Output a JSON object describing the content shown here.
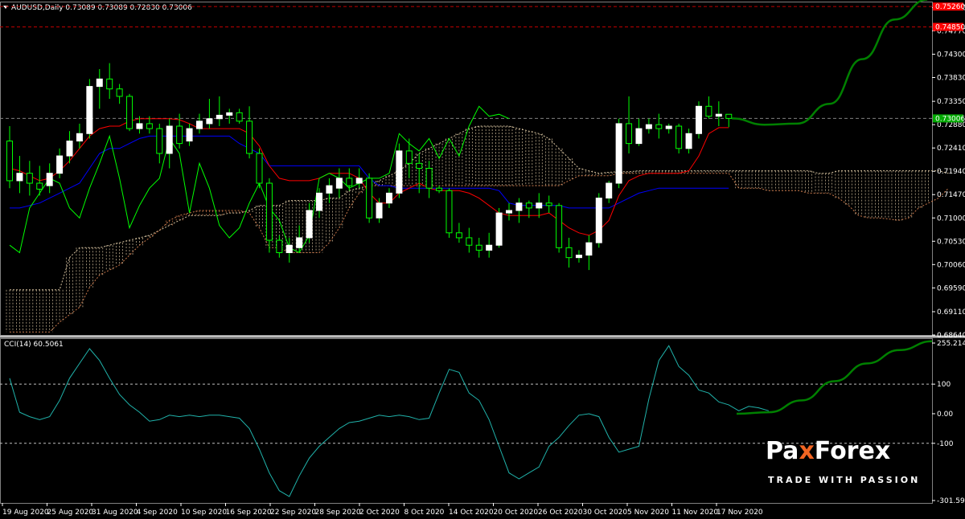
{
  "header": {
    "symbol_label": "AUDUSD,Daily",
    "ohlc_label": "0.73089 0.73089 0.72830 0.73006"
  },
  "indicator": {
    "label": "CCI(14) 60.5061"
  },
  "colors": {
    "background": "#000000",
    "bull_candle": "#ffffff",
    "bear_candle": "#000000",
    "wick": "#00ff00",
    "tenkan": "#ff0000",
    "kijun": "#0000ff",
    "chikou": "#00ff00",
    "cloud_a": "#d7c3a0",
    "cloud_b": "#c8784b",
    "cci": "#20b2aa",
    "forecast": "#008000",
    "level_line": "#c00000",
    "price_tag": "#ff0000",
    "current_tag": "#00aa00"
  },
  "chart_data": [
    {
      "type": "candlestick",
      "title": "AUDUSD,Daily",
      "ylim": [
        0.6864,
        0.7536
      ],
      "y_ticks": [
        "0.75240",
        "0.74770",
        "0.74300",
        "0.73830",
        "0.73350",
        "0.72880",
        "0.72410",
        "0.71940",
        "0.71470",
        "0.71000",
        "0.70530",
        "0.70060",
        "0.69590",
        "0.69110",
        "0.68640"
      ],
      "price_tags": [
        {
          "label": "0.75260",
          "value": 0.7526,
          "color": "#ff0000"
        },
        {
          "label": "0.74850",
          "value": 0.7485,
          "color": "#ff0000"
        },
        {
          "label": "0.73006",
          "value": 0.73006,
          "color": "#00aa00"
        }
      ],
      "x_labels": [
        "19 Aug 2020",
        "25 Aug 2020",
        "31 Aug 2020",
        "4 Sep 2020",
        "10 Sep 2020",
        "16 Sep 2020",
        "22 Sep 2020",
        "28 Sep 2020",
        "2 Oct 2020",
        "8 Oct 2020",
        "14 Oct 2020",
        "20 Oct 2020",
        "26 Oct 2020",
        "30 Oct 2020",
        "5 Nov 2020",
        "11 Nov 2020",
        "17 Nov 2020"
      ],
      "candles": [
        {
          "o": 0.7255,
          "h": 0.7285,
          "l": 0.716,
          "c": 0.7175
        },
        {
          "o": 0.7175,
          "h": 0.7225,
          "l": 0.715,
          "c": 0.719
        },
        {
          "o": 0.719,
          "h": 0.7215,
          "l": 0.7145,
          "c": 0.717
        },
        {
          "o": 0.717,
          "h": 0.7205,
          "l": 0.7145,
          "c": 0.7158
        },
        {
          "o": 0.7165,
          "h": 0.721,
          "l": 0.715,
          "c": 0.719
        },
        {
          "o": 0.719,
          "h": 0.724,
          "l": 0.718,
          "c": 0.7225
        },
        {
          "o": 0.7225,
          "h": 0.7275,
          "l": 0.721,
          "c": 0.7255
        },
        {
          "o": 0.7255,
          "h": 0.729,
          "l": 0.724,
          "c": 0.727
        },
        {
          "o": 0.727,
          "h": 0.738,
          "l": 0.726,
          "c": 0.7365
        },
        {
          "o": 0.7365,
          "h": 0.74,
          "l": 0.732,
          "c": 0.738
        },
        {
          "o": 0.738,
          "h": 0.7412,
          "l": 0.734,
          "c": 0.736
        },
        {
          "o": 0.736,
          "h": 0.737,
          "l": 0.733,
          "c": 0.7345
        },
        {
          "o": 0.7345,
          "h": 0.735,
          "l": 0.7275,
          "c": 0.728
        },
        {
          "o": 0.728,
          "h": 0.7305,
          "l": 0.727,
          "c": 0.729
        },
        {
          "o": 0.729,
          "h": 0.7305,
          "l": 0.727,
          "c": 0.728
        },
        {
          "o": 0.728,
          "h": 0.729,
          "l": 0.721,
          "c": 0.723
        },
        {
          "o": 0.723,
          "h": 0.73,
          "l": 0.72,
          "c": 0.7285
        },
        {
          "o": 0.7285,
          "h": 0.731,
          "l": 0.724,
          "c": 0.725
        },
        {
          "o": 0.7255,
          "h": 0.729,
          "l": 0.7245,
          "c": 0.728
        },
        {
          "o": 0.728,
          "h": 0.731,
          "l": 0.727,
          "c": 0.7295
        },
        {
          "o": 0.729,
          "h": 0.734,
          "l": 0.728,
          "c": 0.73
        },
        {
          "o": 0.73,
          "h": 0.7345,
          "l": 0.7285,
          "c": 0.7307
        },
        {
          "o": 0.7307,
          "h": 0.732,
          "l": 0.729,
          "c": 0.7312
        },
        {
          "o": 0.7312,
          "h": 0.732,
          "l": 0.729,
          "c": 0.7295
        },
        {
          "o": 0.7295,
          "h": 0.7325,
          "l": 0.722,
          "c": 0.723
        },
        {
          "o": 0.723,
          "h": 0.724,
          "l": 0.716,
          "c": 0.717
        },
        {
          "o": 0.717,
          "h": 0.718,
          "l": 0.703,
          "c": 0.7055
        },
        {
          "o": 0.7055,
          "h": 0.7065,
          "l": 0.702,
          "c": 0.703
        },
        {
          "o": 0.703,
          "h": 0.706,
          "l": 0.701,
          "c": 0.7045
        },
        {
          "o": 0.704,
          "h": 0.7085,
          "l": 0.703,
          "c": 0.706
        },
        {
          "o": 0.706,
          "h": 0.713,
          "l": 0.705,
          "c": 0.7115
        },
        {
          "o": 0.7115,
          "h": 0.716,
          "l": 0.71,
          "c": 0.715
        },
        {
          "o": 0.715,
          "h": 0.718,
          "l": 0.713,
          "c": 0.7165
        },
        {
          "o": 0.716,
          "h": 0.72,
          "l": 0.714,
          "c": 0.718
        },
        {
          "o": 0.718,
          "h": 0.72,
          "l": 0.7155,
          "c": 0.7165
        },
        {
          "o": 0.717,
          "h": 0.72,
          "l": 0.716,
          "c": 0.718
        },
        {
          "o": 0.718,
          "h": 0.719,
          "l": 0.709,
          "c": 0.71
        },
        {
          "o": 0.71,
          "h": 0.714,
          "l": 0.709,
          "c": 0.713
        },
        {
          "o": 0.713,
          "h": 0.716,
          "l": 0.712,
          "c": 0.715
        },
        {
          "o": 0.715,
          "h": 0.725,
          "l": 0.714,
          "c": 0.7235
        },
        {
          "o": 0.7235,
          "h": 0.726,
          "l": 0.718,
          "c": 0.721
        },
        {
          "o": 0.721,
          "h": 0.723,
          "l": 0.715,
          "c": 0.72
        },
        {
          "o": 0.72,
          "h": 0.7215,
          "l": 0.714,
          "c": 0.716
        },
        {
          "o": 0.716,
          "h": 0.7165,
          "l": 0.715,
          "c": 0.7155
        },
        {
          "o": 0.7155,
          "h": 0.716,
          "l": 0.706,
          "c": 0.707
        },
        {
          "o": 0.707,
          "h": 0.709,
          "l": 0.705,
          "c": 0.706
        },
        {
          "o": 0.706,
          "h": 0.708,
          "l": 0.703,
          "c": 0.7045
        },
        {
          "o": 0.7045,
          "h": 0.706,
          "l": 0.702,
          "c": 0.7035
        },
        {
          "o": 0.7035,
          "h": 0.707,
          "l": 0.702,
          "c": 0.7045
        },
        {
          "o": 0.7045,
          "h": 0.712,
          "l": 0.704,
          "c": 0.711
        },
        {
          "o": 0.711,
          "h": 0.713,
          "l": 0.7095,
          "c": 0.7115
        },
        {
          "o": 0.7115,
          "h": 0.714,
          "l": 0.709,
          "c": 0.713
        },
        {
          "o": 0.713,
          "h": 0.7135,
          "l": 0.71,
          "c": 0.712
        },
        {
          "o": 0.712,
          "h": 0.715,
          "l": 0.71,
          "c": 0.713
        },
        {
          "o": 0.713,
          "h": 0.7145,
          "l": 0.711,
          "c": 0.7125
        },
        {
          "o": 0.7125,
          "h": 0.713,
          "l": 0.703,
          "c": 0.704
        },
        {
          "o": 0.704,
          "h": 0.706,
          "l": 0.7,
          "c": 0.702
        },
        {
          "o": 0.702,
          "h": 0.7035,
          "l": 0.701,
          "c": 0.7025
        },
        {
          "o": 0.7025,
          "h": 0.7065,
          "l": 0.6995,
          "c": 0.705
        },
        {
          "o": 0.705,
          "h": 0.715,
          "l": 0.704,
          "c": 0.714
        },
        {
          "o": 0.714,
          "h": 0.7175,
          "l": 0.713,
          "c": 0.717
        },
        {
          "o": 0.717,
          "h": 0.73,
          "l": 0.716,
          "c": 0.729
        },
        {
          "o": 0.729,
          "h": 0.7345,
          "l": 0.723,
          "c": 0.725
        },
        {
          "o": 0.725,
          "h": 0.73,
          "l": 0.7245,
          "c": 0.728
        },
        {
          "o": 0.728,
          "h": 0.73,
          "l": 0.727,
          "c": 0.7288
        },
        {
          "o": 0.7288,
          "h": 0.731,
          "l": 0.726,
          "c": 0.728
        },
        {
          "o": 0.728,
          "h": 0.729,
          "l": 0.727,
          "c": 0.7285
        },
        {
          "o": 0.7285,
          "h": 0.729,
          "l": 0.723,
          "c": 0.724
        },
        {
          "o": 0.724,
          "h": 0.728,
          "l": 0.723,
          "c": 0.727
        },
        {
          "o": 0.727,
          "h": 0.7335,
          "l": 0.726,
          "c": 0.7325
        },
        {
          "o": 0.7325,
          "h": 0.7345,
          "l": 0.73,
          "c": 0.7305
        },
        {
          "o": 0.7305,
          "h": 0.7335,
          "l": 0.7285,
          "c": 0.7309
        },
        {
          "o": 0.73089,
          "h": 0.73089,
          "l": 0.7283,
          "c": 0.73006
        }
      ],
      "tenkan": [
        0.72,
        0.7195,
        0.7185,
        0.7175,
        0.718,
        0.7195,
        0.7215,
        0.724,
        0.7265,
        0.728,
        0.7285,
        0.7285,
        0.7295,
        0.73,
        0.73,
        0.73,
        0.73,
        0.7298,
        0.729,
        0.728,
        0.728,
        0.728,
        0.728,
        0.728,
        0.727,
        0.7245,
        0.7205,
        0.718,
        0.7175,
        0.7175,
        0.7175,
        0.718,
        0.719,
        0.719,
        0.719,
        0.718,
        0.715,
        0.713,
        0.713,
        0.715,
        0.716,
        0.717,
        0.716,
        0.7155,
        0.7155,
        0.7155,
        0.715,
        0.714,
        0.7125,
        0.711,
        0.7105,
        0.7105,
        0.7105,
        0.7105,
        0.711,
        0.7095,
        0.708,
        0.707,
        0.7065,
        0.7075,
        0.7095,
        0.7145,
        0.7175,
        0.7185,
        0.719,
        0.719,
        0.719,
        0.719,
        0.7195,
        0.7225,
        0.727,
        0.7282,
        0.7282
      ],
      "kijun": [
        0.712,
        0.712,
        0.7125,
        0.713,
        0.714,
        0.715,
        0.716,
        0.717,
        0.72,
        0.723,
        0.724,
        0.724,
        0.725,
        0.726,
        0.7265,
        0.7265,
        0.7265,
        0.7265,
        0.7265,
        0.7265,
        0.7265,
        0.7265,
        0.7265,
        0.725,
        0.724,
        0.723,
        0.7205,
        0.7205,
        0.7205,
        0.7205,
        0.7205,
        0.7205,
        0.7205,
        0.7205,
        0.7205,
        0.7205,
        0.718,
        0.7165,
        0.7165,
        0.716,
        0.716,
        0.716,
        0.716,
        0.716,
        0.716,
        0.716,
        0.716,
        0.716,
        0.716,
        0.7155,
        0.713,
        0.7125,
        0.7125,
        0.7125,
        0.7125,
        0.7125,
        0.712,
        0.712,
        0.712,
        0.712,
        0.712,
        0.713,
        0.714,
        0.715,
        0.7155,
        0.716,
        0.716,
        0.716,
        0.716,
        0.716,
        0.716,
        0.716,
        0.716
      ],
      "chikou": [
        0.7045,
        0.703,
        0.712,
        0.715,
        0.718,
        0.717,
        0.712,
        0.71,
        0.716,
        0.721,
        0.7265,
        0.718,
        0.708,
        0.7125,
        0.716,
        0.718,
        0.726,
        0.723,
        0.711,
        0.721,
        0.716,
        0.7085,
        0.706,
        0.708,
        0.713,
        0.717,
        0.712,
        0.7095,
        0.704,
        0.703,
        0.7065,
        0.718,
        0.719,
        0.718,
        0.716,
        0.717,
        0.718,
        0.718,
        0.719,
        0.727,
        0.725,
        0.7235,
        0.726,
        0.722,
        0.726,
        0.7225,
        0.7285,
        0.7325,
        0.7305,
        0.7309,
        0.73
      ],
      "cloud_a": [
        0.6955,
        0.6955,
        0.6955,
        0.6955,
        0.6955,
        0.6955,
        0.702,
        0.704,
        0.704,
        0.704,
        0.7045,
        0.705,
        0.7055,
        0.706,
        0.7065,
        0.7075,
        0.7085,
        0.7095,
        0.7105,
        0.7105,
        0.7105,
        0.7105,
        0.711,
        0.711,
        0.7115,
        0.7125,
        0.7125,
        0.7125,
        0.7135,
        0.7135,
        0.7135,
        0.7135,
        0.714,
        0.714,
        0.7155,
        0.716,
        0.7165,
        0.7175,
        0.7185,
        0.7195,
        0.721,
        0.723,
        0.724,
        0.725,
        0.726,
        0.727,
        0.728,
        0.7285,
        0.7285,
        0.7285,
        0.7285,
        0.728,
        0.7275,
        0.727,
        0.726,
        0.724,
        0.722,
        0.72,
        0.7195,
        0.719,
        0.7192,
        0.7193,
        0.7193,
        0.7195,
        0.7195,
        0.7195,
        0.7195,
        0.7195,
        0.7195,
        0.7195,
        0.7195,
        0.7195,
        0.7195,
        0.7195,
        0.7195,
        0.7195,
        0.7195,
        0.7195,
        0.7195,
        0.7195,
        0.7195,
        0.719,
        0.719,
        0.7195,
        0.7195,
        0.7195,
        0.7195,
        0.7195,
        0.7195,
        0.7195,
        0.7195,
        0.7195,
        0.7195,
        0.7195,
        0.719
      ],
      "cloud_b": [
        0.687,
        0.687,
        0.687,
        0.687,
        0.687,
        0.689,
        0.6905,
        0.692,
        0.696,
        0.6985,
        0.6995,
        0.7005,
        0.7025,
        0.7045,
        0.706,
        0.7075,
        0.7095,
        0.7105,
        0.711,
        0.7115,
        0.7115,
        0.7115,
        0.7115,
        0.7115,
        0.711,
        0.708,
        0.704,
        0.704,
        0.703,
        0.703,
        0.703,
        0.703,
        0.705,
        0.708,
        0.712,
        0.715,
        0.7165,
        0.7165,
        0.7165,
        0.7165,
        0.7165,
        0.7165,
        0.7165,
        0.7165,
        0.7165,
        0.7165,
        0.7165,
        0.7165,
        0.7165,
        0.7165,
        0.7165,
        0.7165,
        0.7165,
        0.7165,
        0.7165,
        0.7165,
        0.7175,
        0.7185,
        0.7185,
        0.7185,
        0.7185,
        0.719,
        0.719,
        0.719,
        0.719,
        0.719,
        0.719,
        0.719,
        0.719,
        0.719,
        0.719,
        0.719,
        0.719,
        0.716,
        0.716,
        0.716,
        0.7155,
        0.7155,
        0.7155,
        0.7155,
        0.715,
        0.715,
        0.715,
        0.714,
        0.7125,
        0.7105,
        0.71,
        0.71,
        0.7098,
        0.7095,
        0.71,
        0.712,
        0.713,
        0.714,
        0.716
      ],
      "levels": [
        0.7526,
        0.7485,
        0.73006
      ],
      "forecast": [
        [
          0,
          0.73006
        ],
        [
          6,
          0.7288
        ],
        [
          12,
          0.729
        ],
        [
          18,
          0.733
        ],
        [
          24,
          0.742
        ],
        [
          30,
          0.75
        ],
        [
          36,
          0.754
        ]
      ]
    },
    {
      "type": "line",
      "title": "CCI(14) 60.5061",
      "ylim": [
        -301.5993,
        255.2147
      ],
      "y_ticks": [
        "255.2147",
        "100",
        "0.00",
        "-100",
        "-301.5993"
      ],
      "levels": [
        100,
        -100
      ],
      "values": [
        120,
        5,
        -10,
        -20,
        -10,
        45,
        120,
        170,
        220,
        180,
        120,
        65,
        30,
        5,
        -25,
        -20,
        -5,
        -10,
        -5,
        -10,
        -5,
        -5,
        -10,
        -15,
        -50,
        -120,
        -200,
        -260,
        -280,
        -210,
        -150,
        -110,
        -80,
        -50,
        -30,
        -25,
        -15,
        -5,
        -10,
        -5,
        -10,
        -20,
        -15,
        70,
        150,
        140,
        70,
        45,
        -20,
        -110,
        -200,
        -220,
        -200,
        -180,
        -110,
        -80,
        -40,
        -5,
        0,
        -10,
        -80,
        -130,
        -120,
        -110,
        50,
        180,
        230,
        160,
        130,
        80,
        70,
        40,
        30,
        10,
        25,
        20,
        10
      ],
      "forecast": [
        [
          0,
          0.0
        ],
        [
          6,
          5
        ],
        [
          12,
          45
        ],
        [
          18,
          110
        ],
        [
          24,
          170
        ],
        [
          30,
          215
        ],
        [
          36,
          245
        ]
      ]
    }
  ]
}
